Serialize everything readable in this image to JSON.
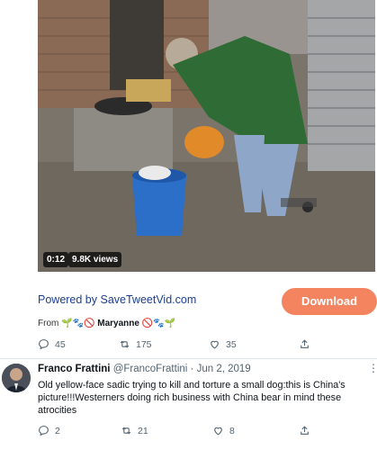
{
  "embedded_tweet": {
    "video": {
      "duration": "0:12",
      "views": "9.8K views"
    },
    "powered_by": "Powered by SaveTweetVid.com",
    "download_label": "Download",
    "from_label": "From",
    "from_emoji_before": "🌱🐾🚫",
    "from_name": "Maryanne",
    "from_emoji_after": "🚫🐾🌱",
    "actions": {
      "replies": "45",
      "retweets": "175",
      "likes": "35"
    }
  },
  "tweet": {
    "name": "Franco Frattini",
    "handle": "@FrancoFrattini",
    "separator": "·",
    "date": "Jun 2, 2019",
    "more": "⋮",
    "text": "Old yellow-face sadic trying to kill and torture a small dog:this is China's picture!!!Westerners doing rich business with China bear in mind these atrocities",
    "actions": {
      "replies": "2",
      "retweets": "21",
      "likes": "8"
    }
  },
  "icons": {
    "reply": "reply-icon",
    "retweet": "retweet-icon",
    "like": "heart-icon",
    "share": "share-icon"
  }
}
